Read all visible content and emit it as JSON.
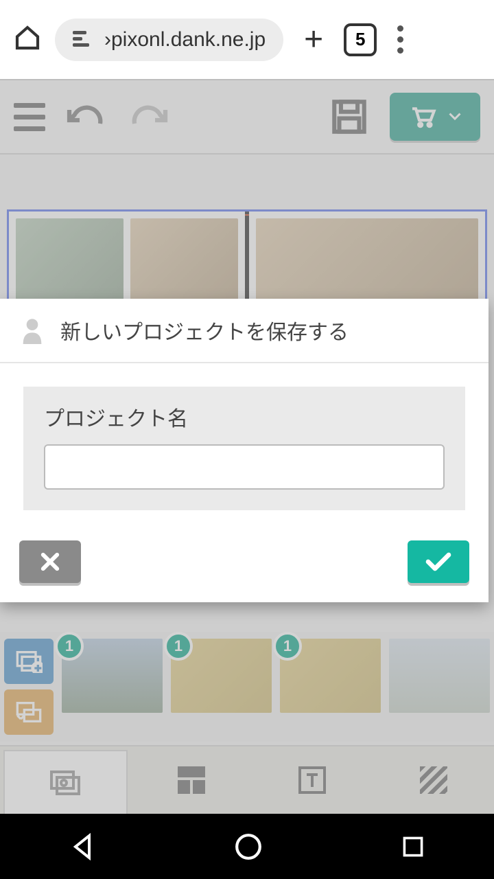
{
  "browser": {
    "url": "›pixonl.dank.ne.jp",
    "tab_count": "5"
  },
  "dialog": {
    "title": "新しいプロジェクトを保存する",
    "field_label": "プロジェクト名",
    "input_value": ""
  },
  "thumbnails": {
    "badges": [
      "1",
      "1",
      "1"
    ]
  }
}
